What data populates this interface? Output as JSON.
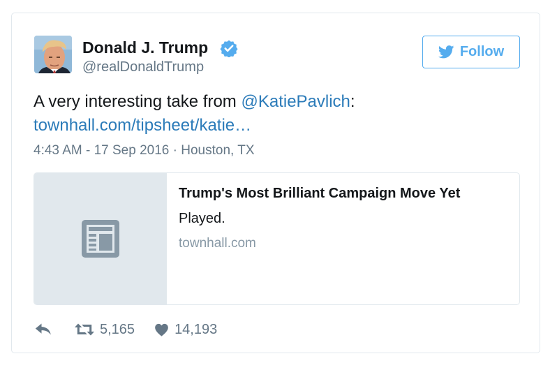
{
  "user": {
    "display_name": "Donald J. Trump",
    "screen_name": "@realDonaldTrump",
    "verified": true
  },
  "follow_button": {
    "label": "Follow"
  },
  "tweet": {
    "text_prefix": "A very interesting take from ",
    "mention": "@KatiePavlich",
    "text_suffix": ":",
    "link": "townhall.com/tipsheet/katie…",
    "timestamp": "4:43 AM - 17 Sep 2016",
    "separator": " · ",
    "location": "Houston, TX"
  },
  "link_card": {
    "title": "Trump's Most Brilliant Campaign Move Yet",
    "description": "Played.",
    "domain": "townhall.com",
    "thumbnail_icon": "newspaper-icon"
  },
  "actions": {
    "reply_icon": "reply-icon",
    "retweet_icon": "retweet-icon",
    "retweet_count": "5,165",
    "like_icon": "heart-icon",
    "like_count": "14,193"
  },
  "colors": {
    "brand_blue": "#55acee",
    "link_blue": "#2b7bb9",
    "text_primary": "#14171a",
    "text_secondary": "#657786",
    "border": "#e1e8ed",
    "thumbnail_bg": "#e1e8ed",
    "thumbnail_icon": "#8899a6"
  }
}
